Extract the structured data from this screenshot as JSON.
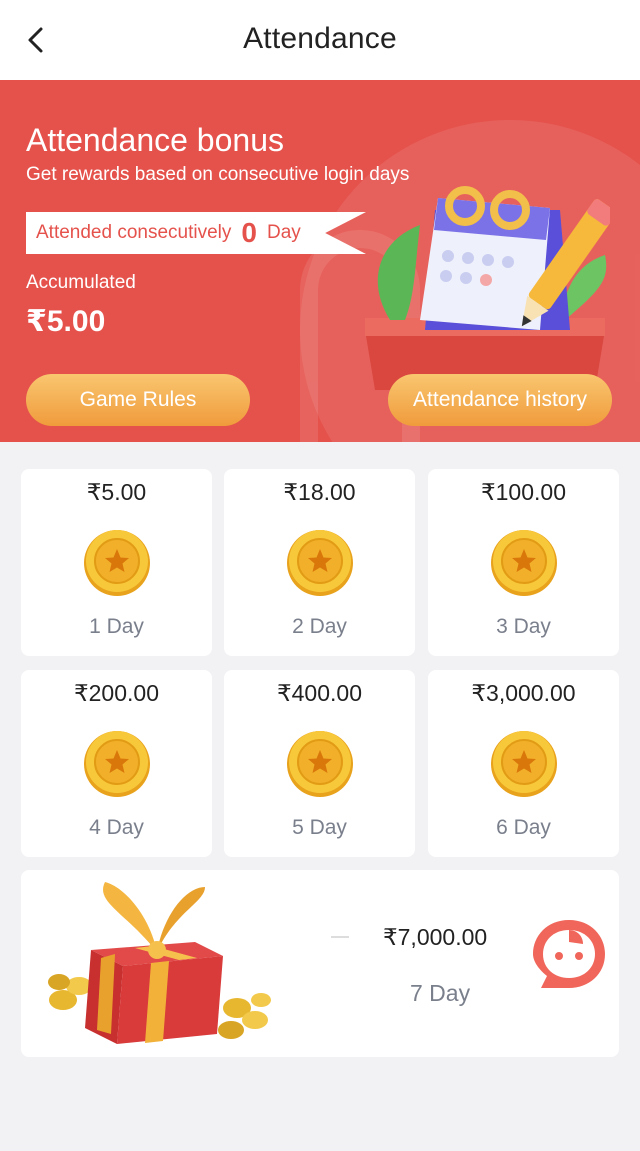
{
  "header": {
    "title": "Attendance",
    "back_icon": "chevron-left-icon"
  },
  "hero": {
    "title": "Attendance bonus",
    "subtitle": "Get rewards based on consecutive login days",
    "ribbon_prefix": "Attended consecutively",
    "ribbon_count": "0",
    "ribbon_suffix": "Day",
    "accumulated_label": "Accumulated",
    "accumulated_value": "₹5.00",
    "rules_button": "Game Rules",
    "history_button": "Attendance history",
    "bg_color": "#e5524c"
  },
  "days": [
    {
      "amount": "₹5.00",
      "label": "1 Day"
    },
    {
      "amount": "₹18.00",
      "label": "2 Day"
    },
    {
      "amount": "₹100.00",
      "label": "3 Day"
    },
    {
      "amount": "₹200.00",
      "label": "4 Day"
    },
    {
      "amount": "₹400.00",
      "label": "5 Day"
    },
    {
      "amount": "₹3,000.00",
      "label": "6 Day"
    }
  ],
  "day7": {
    "amount": "₹7,000.00",
    "label": "7 Day",
    "icon": "gift-box-icon"
  },
  "support": {
    "icon": "chat-support-icon"
  }
}
